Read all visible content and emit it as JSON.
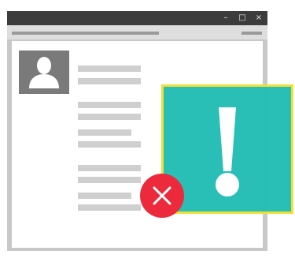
{
  "window": {
    "controls": {
      "minimize": "–",
      "maximize": "□",
      "close": "×"
    }
  },
  "icons": {
    "avatar": "user-silhouette-icon",
    "alert": "exclamation-icon",
    "error": "x-close-icon"
  },
  "colors": {
    "titlebar": "#3c3c3c",
    "alert_panel": "#23bdb5",
    "alert_border": "#f0e030",
    "error": "#ed2a3b",
    "placeholder": "#cfcfcf"
  }
}
